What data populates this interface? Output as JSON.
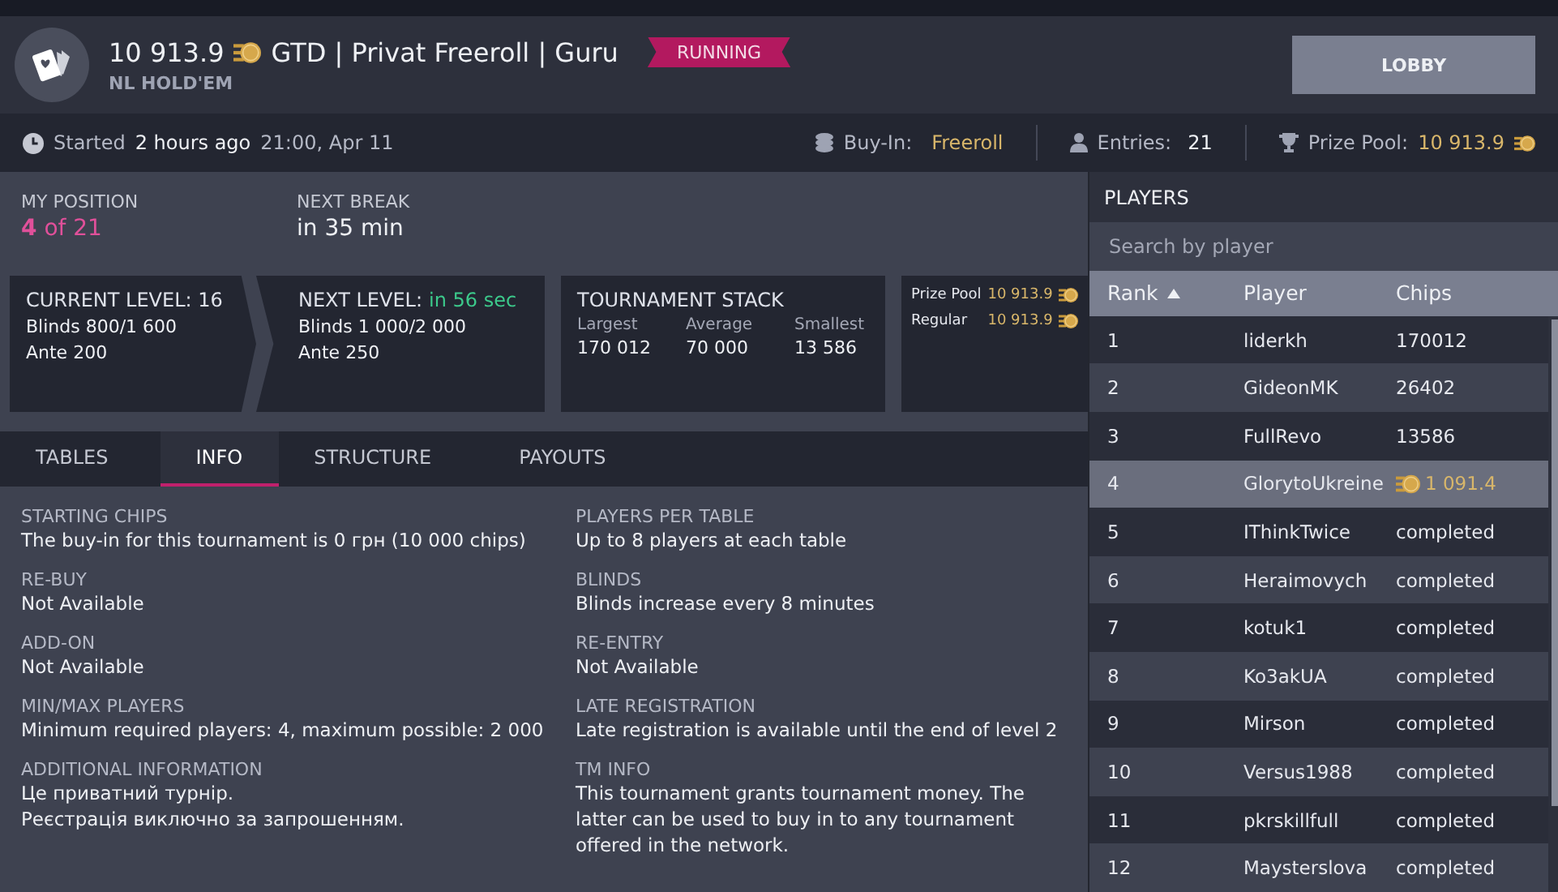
{
  "header": {
    "amount": "10 913.9",
    "name": "GTD | Privat Freeroll | Guru",
    "game": "NL HOLD'EM",
    "status": "RUNNING",
    "lobby_button": "LOBBY"
  },
  "info_bar": {
    "started_label": "Started",
    "started_ago": "2 hours ago",
    "started_time": "21:00, Apr 11",
    "buyin_label": "Buy-In:",
    "buyin_value": "Freeroll",
    "entries_label": "Entries:",
    "entries_value": "21",
    "prize_label": "Prize Pool:",
    "prize_value": "10 913.9"
  },
  "position": {
    "label": "MY POSITION",
    "value": "**4** of 21"
  },
  "next_break": {
    "label": "NEXT BREAK",
    "value": "in 35 min"
  },
  "current_level": {
    "title": "CURRENT LEVEL: 16",
    "blinds": "Blinds 800/1 600",
    "ante": "Ante 200"
  },
  "next_level": {
    "title": "NEXT LEVEL:",
    "countdown": "in 56 sec",
    "blinds": "Blinds 1 000/2 000",
    "ante": "Ante 250"
  },
  "tournament_stack": {
    "title": "TOURNAMENT STACK",
    "columns": [
      {
        "label": "Largest",
        "value": "170 012"
      },
      {
        "label": "Average",
        "value": "70 000"
      },
      {
        "label": "Smallest",
        "value": "13 586"
      }
    ]
  },
  "prizes": [
    {
      "label": "Prize Pool",
      "value": "10 913.9"
    },
    {
      "label": "Regular",
      "value": "10 913.9"
    }
  ],
  "tabs": [
    {
      "label": "TABLES",
      "selected": false
    },
    {
      "label": "INFO",
      "selected": true
    },
    {
      "label": "STRUCTURE",
      "selected": false
    },
    {
      "label": "PAYOUTS",
      "selected": false
    }
  ],
  "info_columns": [
    [
      {
        "label": "STARTING CHIPS",
        "value": "The buy-in for this tournament is 0 грн (10 000 chips)"
      },
      {
        "label": "RE-BUY",
        "value": "Not Available"
      },
      {
        "label": "ADD-ON",
        "value": "Not Available"
      },
      {
        "label": "MIN/MAX PLAYERS",
        "value": "Minimum required players: 4, maximum possible: 2 000"
      },
      {
        "label": "ADDITIONAL INFORMATION",
        "value": "Це приватний турнір.\nРеєстрація виключно за запрошенням."
      }
    ],
    [
      {
        "label": "PLAYERS PER TABLE",
        "value": "Up to 8 players at each table"
      },
      {
        "label": "BLINDS",
        "value": "Blinds increase every 8 minutes"
      },
      {
        "label": "RE-ENTRY",
        "value": "Not Available"
      },
      {
        "label": "LATE REGISTRATION",
        "value": "Late registration is available until the end of level 2"
      },
      {
        "label": "TM INFO",
        "value": "This tournament grants tournament money. The latter can be used to buy in to any tournament offered in the network."
      }
    ]
  ],
  "players": {
    "title": "PLAYERS",
    "search_placeholder": "Search by player",
    "columns": [
      "Rank",
      "Player",
      "Chips"
    ],
    "rows": [
      {
        "rank": "1",
        "player": "liderkh",
        "chips": "170012",
        "kind": "plain",
        "selected": false
      },
      {
        "rank": "2",
        "player": "GideonMK",
        "chips": "26402",
        "kind": "plain",
        "selected": false
      },
      {
        "rank": "3",
        "player": "FullRevo",
        "chips": "13586",
        "kind": "plain",
        "selected": false
      },
      {
        "rank": "4",
        "player": "GlorytoUkreine",
        "chips": "1 091.4",
        "kind": "money",
        "selected": true
      },
      {
        "rank": "5",
        "player": "IThinkTwice",
        "chips": "completed",
        "kind": "plain",
        "selected": false
      },
      {
        "rank": "6",
        "player": "Heraimovych",
        "chips": "completed",
        "kind": "plain",
        "selected": false
      },
      {
        "rank": "7",
        "player": "kotuk1",
        "chips": "completed",
        "kind": "plain",
        "selected": false
      },
      {
        "rank": "8",
        "player": "Ko3akUA",
        "chips": "completed",
        "kind": "plain",
        "selected": false
      },
      {
        "rank": "9",
        "player": "Mirson",
        "chips": "completed",
        "kind": "plain",
        "selected": false
      },
      {
        "rank": "10",
        "player": "Versus1988",
        "chips": "completed",
        "kind": "plain",
        "selected": false
      },
      {
        "rank": "11",
        "player": "pkrskillfull",
        "chips": "completed",
        "kind": "plain",
        "selected": false
      },
      {
        "rank": "12",
        "player": "Maysterslova",
        "chips": "completed",
        "kind": "plain",
        "selected": false
      }
    ]
  }
}
